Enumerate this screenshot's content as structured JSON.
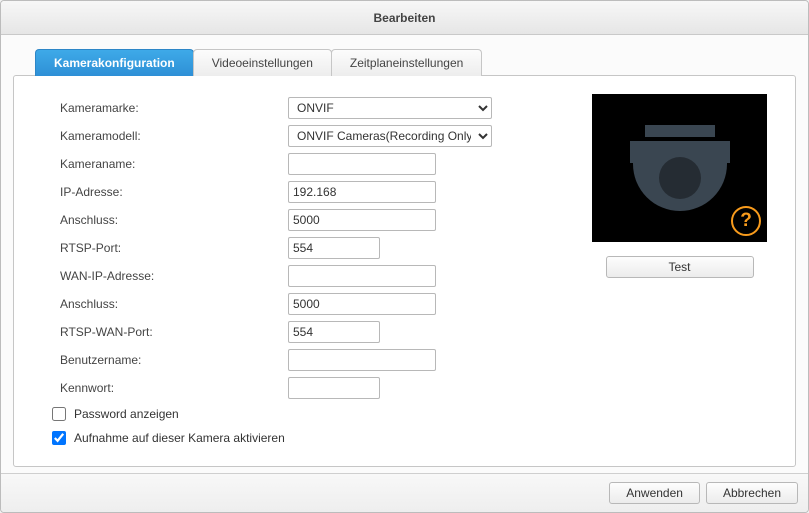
{
  "window": {
    "title": "Bearbeiten"
  },
  "tabs": {
    "config": "Kamerakonfiguration",
    "video": "Videoeinstellungen",
    "schedule": "Zeitplaneinstellungen"
  },
  "form": {
    "brand_label": "Kameramarke:",
    "brand_value": "ONVIF",
    "model_label": "Kameramodell:",
    "model_value": "ONVIF Cameras(Recording Only)",
    "name_label": "Kameraname:",
    "name_value": "",
    "ip_label": "IP-Adresse:",
    "ip_value": "192.168",
    "port_label": "Anschluss:",
    "port_value": "5000",
    "rtsp_label": "RTSP-Port:",
    "rtsp_value": "554",
    "wanip_label": "WAN-IP-Adresse:",
    "wanip_value": "",
    "wanport_label": "Anschluss:",
    "wanport_value": "5000",
    "rtspwan_label": "RTSP-WAN-Port:",
    "rtspwan_value": "554",
    "user_label": "Benutzername:",
    "user_value": "",
    "pass_label": "Kennwort:",
    "pass_value": "",
    "showpw_label": "Password anzeigen",
    "showpw_checked": false,
    "enable_label": "Aufnahme auf dieser Kamera aktivieren",
    "enable_checked": true
  },
  "preview": {
    "help_symbol": "?",
    "test_button": "Test"
  },
  "footer": {
    "apply": "Anwenden",
    "cancel": "Abbrechen"
  }
}
